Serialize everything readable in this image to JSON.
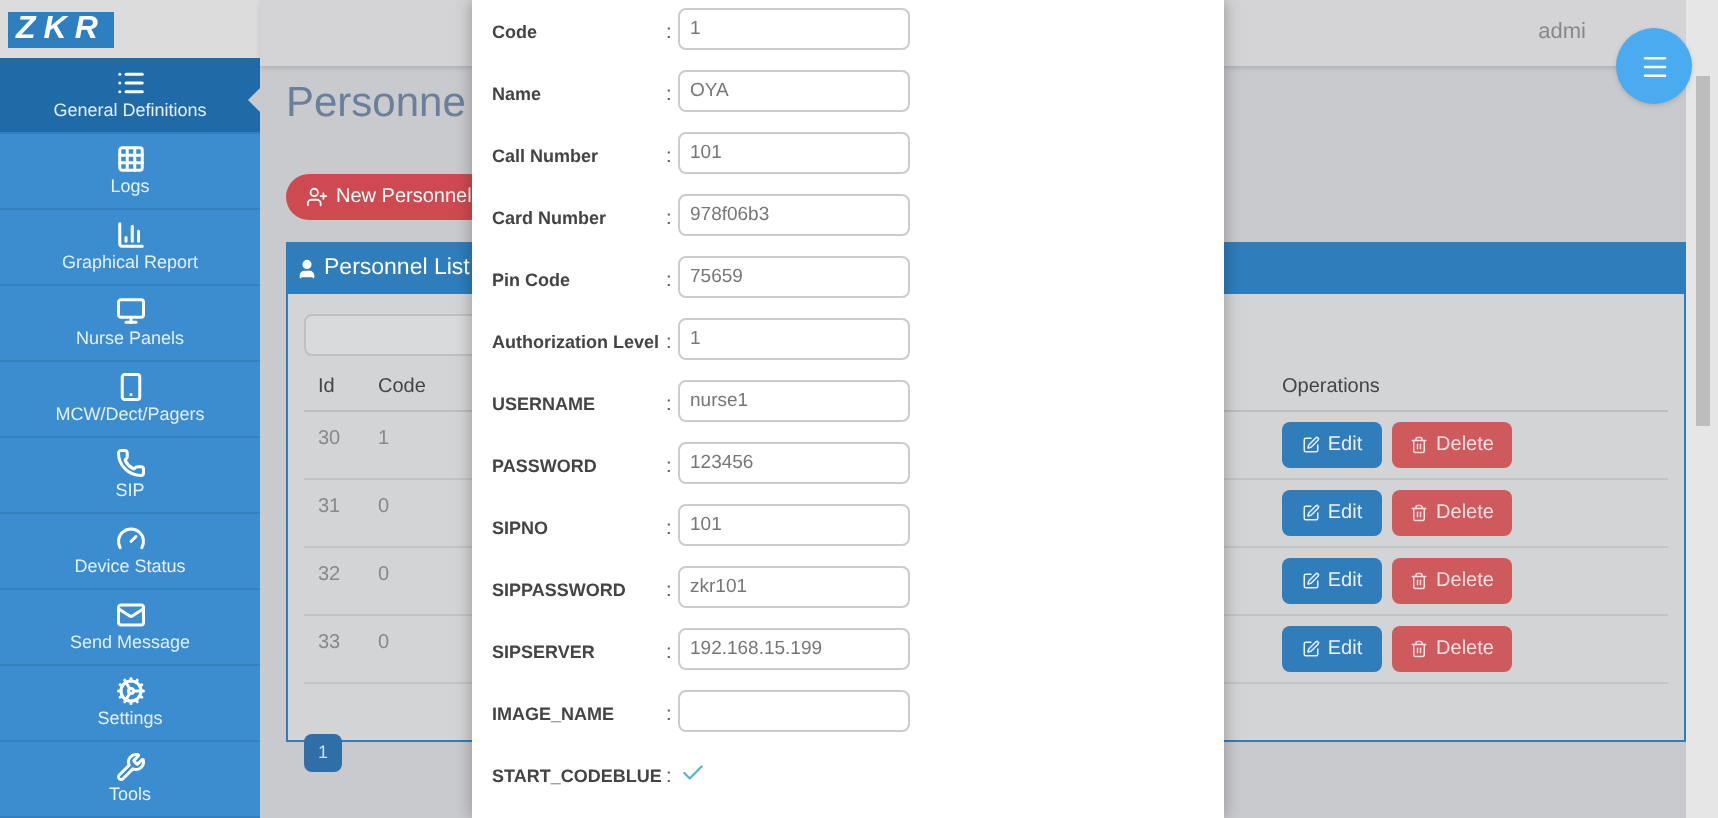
{
  "logo": "ZKR",
  "user": "admi",
  "sidebar": {
    "items": [
      {
        "label": "General Definitions",
        "selected": true
      },
      {
        "label": "Logs",
        "selected": false
      },
      {
        "label": "Graphical Report",
        "selected": false
      },
      {
        "label": "Nurse Panels",
        "selected": false
      },
      {
        "label": "MCW/Dect/Pagers",
        "selected": false
      },
      {
        "label": "SIP",
        "selected": false
      },
      {
        "label": "Device Status",
        "selected": false
      },
      {
        "label": "Send Message",
        "selected": false
      },
      {
        "label": "Settings",
        "selected": false
      },
      {
        "label": "Tools",
        "selected": false
      }
    ]
  },
  "page_title": "Personne",
  "new_button": "New Personnel",
  "panel": {
    "title": "Personnel List",
    "columns": [
      "Id",
      "Code",
      "Operations"
    ],
    "rows": [
      {
        "id": "30",
        "code": "1",
        "edit": "Edit",
        "delete": "Delete"
      },
      {
        "id": "31",
        "code": "0",
        "edit": "Edit",
        "delete": "Delete"
      },
      {
        "id": "32",
        "code": "0",
        "edit": "Edit",
        "delete": "Delete"
      },
      {
        "id": "33",
        "code": "0",
        "edit": "Edit",
        "delete": "Delete"
      }
    ],
    "pagination": [
      {
        "label": "1",
        "selected": true
      }
    ]
  },
  "modal": {
    "fields": [
      {
        "kind": "text",
        "label": "Code",
        "separator": ":",
        "value": "1"
      },
      {
        "kind": "text",
        "label": "Name",
        "separator": ":",
        "value": "OYA"
      },
      {
        "kind": "text",
        "label": "Call Number",
        "separator": ":",
        "value": "101"
      },
      {
        "kind": "text",
        "label": "Card Number",
        "separator": ":",
        "value": "978f06b3"
      },
      {
        "kind": "text",
        "label": "Pin Code",
        "separator": ":",
        "value": "75659"
      },
      {
        "kind": "text",
        "label": "Authorization Level",
        "separator": ":",
        "value": "1"
      },
      {
        "kind": "text",
        "label": "USERNAME",
        "separator": ":",
        "value": "nurse1"
      },
      {
        "kind": "text",
        "label": "PASSWORD",
        "separator": ":",
        "value": "123456"
      },
      {
        "kind": "text",
        "label": "SIPNO",
        "separator": ":",
        "value": "101"
      },
      {
        "kind": "text",
        "label": "SIPPASSWORD",
        "separator": ":",
        "value": "zkr101"
      },
      {
        "kind": "text",
        "label": "SIPSERVER",
        "separator": ":",
        "value": "192.168.15.199"
      },
      {
        "kind": "text",
        "label": "IMAGE_NAME",
        "separator": ":"
      },
      {
        "kind": "checkbox",
        "label": "START_CODEBLUE",
        "separator": ":",
        "checked": true
      }
    ]
  }
}
